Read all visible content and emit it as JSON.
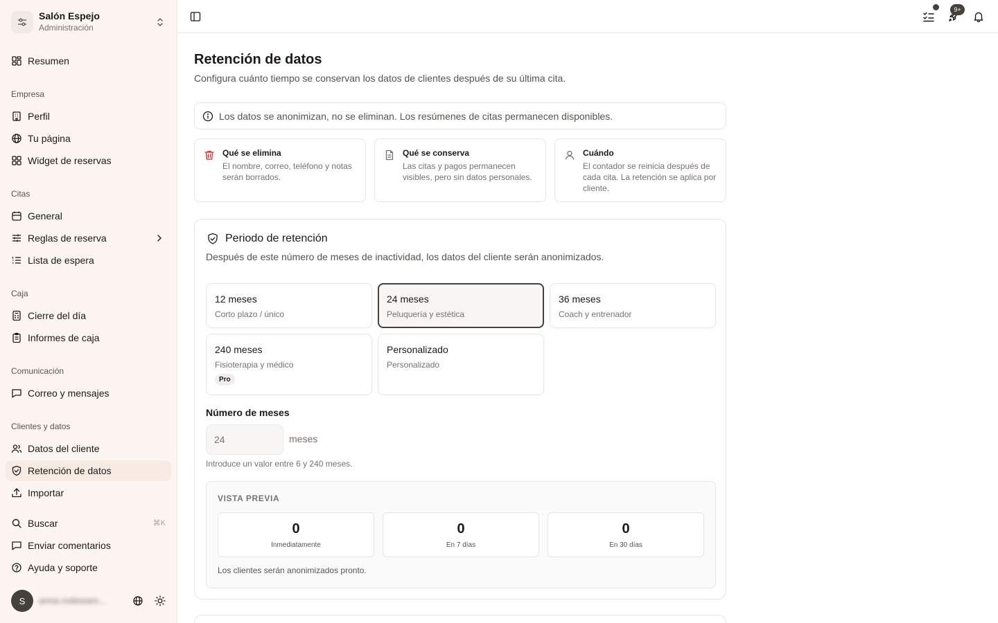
{
  "org": {
    "name": "Salón Espejo",
    "role": "Administración"
  },
  "sidebar": {
    "top": [
      {
        "label": "Resumen",
        "icon": "grid-icon"
      }
    ],
    "groups": {
      "empresa": {
        "label": "Empresa",
        "items": [
          "Perfil",
          "Tu página",
          "Widget de reservas"
        ]
      },
      "citas": {
        "label": "Citas",
        "items": [
          "General",
          "Reglas de reserva",
          "Lista de espera"
        ]
      },
      "caja": {
        "label": "Caja",
        "items": [
          "Cierre del día",
          "Informes de caja"
        ]
      },
      "comunicacion": {
        "label": "Comunicación",
        "items": [
          "Correo y mensajes"
        ]
      },
      "clientes": {
        "label": "Clientes y datos",
        "items": [
          "Datos del cliente",
          "Retención de datos",
          "Importar"
        ]
      }
    },
    "bottom": {
      "search": "Buscar",
      "search_kbd": "⌘K",
      "feedback": "Enviar comentarios",
      "help": "Ayuda y soporte"
    },
    "user": {
      "initial": "S",
      "email": "anna.rodewam..."
    }
  },
  "topbar": {
    "notifications_badge": "9+"
  },
  "page": {
    "title": "Retención de datos",
    "subtitle": "Configura cuánto tiempo se conservan los datos de clientes después de su última cita.",
    "note": "Los datos se anonimizan, no se eliminan. Los resúmenes de citas permanecen disponibles."
  },
  "info_cards": [
    {
      "title": "Qué se elimina",
      "desc": "El nombre, correo, teléfono y notas serán borrados.",
      "icon": "trash-icon",
      "color": "#dc2626"
    },
    {
      "title": "Qué se conserva",
      "desc": "Las citas y pagos permanecen visibles, pero sin datos personales.",
      "icon": "document-icon",
      "color": "#78716c"
    },
    {
      "title": "Cuándo",
      "desc": "El contador se reinicia después de cada cita. La retención se aplica por cliente.",
      "icon": "user-icon",
      "color": "#78716c"
    }
  ],
  "retention": {
    "title": "Periodo de retención",
    "subtitle": "Después de este número de meses de inactividad, los datos del cliente serán anonimizados.",
    "options": [
      {
        "title": "12 meses",
        "desc": "Corto plazo / único"
      },
      {
        "title": "24 meses",
        "desc": "Peluquería y estética"
      },
      {
        "title": "36 meses",
        "desc": "Coach y entrenador"
      },
      {
        "title": "240 meses",
        "desc": "Fisioterapia y médico",
        "badge": "Pro"
      },
      {
        "title": "Personalizado",
        "desc": "Personalizado"
      }
    ],
    "selected": "24 meses",
    "field_label": "Número de meses",
    "field_placeholder": "24",
    "field_unit": "meses",
    "field_hint": "Introduce un valor entre 6 y 240 meses.",
    "preview": {
      "label": "VISTA PREVIA",
      "stats": [
        {
          "value": "0",
          "label": "Inmediatamente"
        },
        {
          "value": "0",
          "label": "En 7 días"
        },
        {
          "value": "0",
          "label": "En 30 días"
        }
      ],
      "footer": "Los clientes serán anonimizados pronto."
    }
  },
  "colors": {
    "accent": "#44403c",
    "sidebar_bg": "#fdf5f1",
    "active_item": "#f8ebe3",
    "danger": "#dc2626"
  }
}
